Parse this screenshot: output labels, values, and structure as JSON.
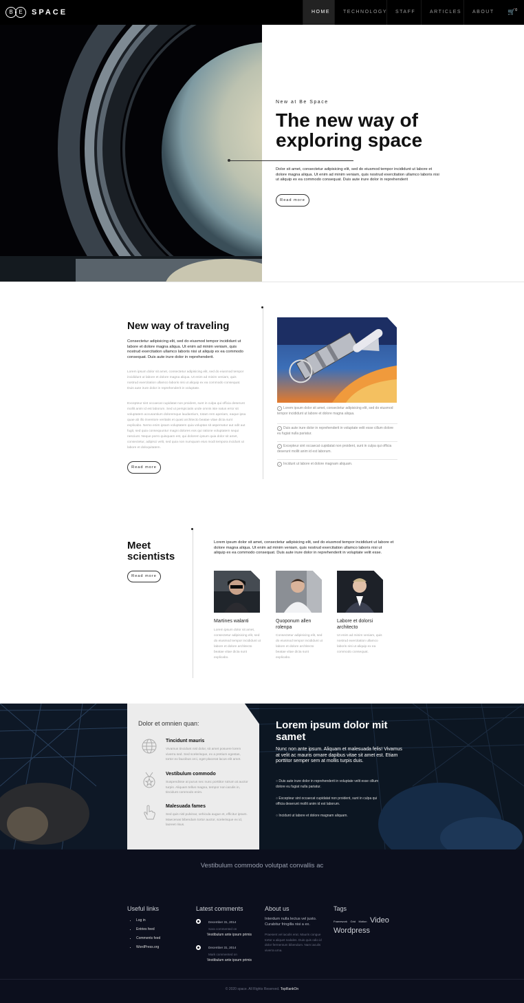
{
  "brand": {
    "logo_letters": "B E",
    "name": "SPACE"
  },
  "nav": {
    "items": [
      "HOME",
      "TECHNOLOGY",
      "STAFF",
      "ARTICLES",
      "ABOUT"
    ],
    "active": "HOME",
    "cart_count": "0"
  },
  "hero": {
    "kicker": "New at Be Space",
    "title": "The new way of exploring space",
    "text": "Dolor sit amet, consectetur adipisicing elit, sed do eiusmod tempor incididunt ut labore et dolore magna aliqua. Ut enim ad minim veniam, quis nostrud exercitation ullamco laboris nisi ut aliquip ex ea commodo consequat. Duis aute irure dolor in reprehenderit",
    "button": "Read more"
  },
  "traveling": {
    "title": "New way of traveling",
    "lead": "Consectetur adipisicing elit, sed do eiusmod tempor incididunt ut labore et dolore magna aliqua. Ut enim ad minim veniam, quis nostrud exercitation ullamco laboris nisi ut aliquip ex ea commodo consequat. Duis aute irure dolor in reprehenderit.",
    "para1": "Lorem ipsum dolor sit amet, consectetur adipisicing elit, sed do eiusmod tempor incididunt ut labore et dolore magna aliqua. Ut enim ad minim veniam, quis nostrud exercitation ullamco laboris nisi ut aliquip ex ea commodo consequat. Duis aute irure dolor in reprehenderit in voluptate.",
    "para2": "Excepteur sint occaecat cupidatat non proident, sunt in culpa qui officia deserunt mollit anim id est laborum. Sed ut perspiciatis unde omnis iste natus error sit voluptatem accusantium doloremque laudantium, totam rem aperiam, eaque ipsa quae ab illo inventore veritatis et quasi architecto beatae vitae dicta sunt explicabo. Nemo enim ipsam voluptatem quia voluptas sit aspernatur aut odit aut fugit, sed quia consequuntur magni dolores eos qui ratione voluptatem sequi nesciunt. Neque porro quisquam est, qui dolorem ipsum quia dolor sit amet, consectetur, adipisci velit, sed quia non numquam eius modi tempora incidunt ut labore et doloquitatem.",
    "button": "Read more",
    "checklist": [
      "Lorem ipsum dolor sit amet, consectetur adipisicing elit, sed do eiusmod tempor incididunt ut labore et dolore magna aliqua.",
      "Duis aute irure dolor in reprehenderit in voluptate velit esse cillum dolore eu fugiat nulla pariatur.",
      "Excepteur sint occaecat cupidatat non proident, sunt in culpa qui officia deserunt mollit anim id est laborum.",
      "Incidunt ut labore et dolore magnam aliquam."
    ]
  },
  "scientists": {
    "title": "Meet scientists",
    "intro": "Lorem ipsum dolor sit amet, consectetur adipisicing elit, sed do eiusmod tempor incididunt ut labore et dolore magna aliqua. Ut enim ad minim veniam, quis nostrud exercitation ullamco laboris nisi ut aliquip ex ea commodo consequat. Duis aute irure dolor in reprehenderit in voluptate velit esse.",
    "button": "Read more",
    "people": [
      {
        "name": "Martines walanti",
        "text": "Lorem ipsum dolor sit amet, consectetur adipisicing elit, sed do eiusmod tempor incididunt ut labore et dolore architecto beatae vitae dicta sunt explicabo."
      },
      {
        "name": "Quoponum allen rolenpa",
        "text": "Consectetur adipisicing elit, sed do eiusmod tempor incididunt ut labore et dolore architecto beatae vitae dicta sunt explicabo."
      },
      {
        "name": "Labore et dolorsi architecto",
        "text": "Ut enim ad minim veniam, quis nostrud exercitation ullamco laboris nisi ut aliquip ex ea commodo consequat."
      }
    ]
  },
  "features": {
    "panel_title": "Dolor et omnien quan:",
    "items": [
      {
        "icon": "globe-icon",
        "title": "Tincidunt mauris",
        "text": "Vivamus tincidunt nisl dolor, sit amet posuere lorem viverra sed. Sed scelerisque, ex a pretium egestas, tortor ex faucibus orci, eget placerat lacus elit amet."
      },
      {
        "icon": "medal-icon",
        "title": "Vestibulum commodo",
        "text": "Suspendisse at purus nec nunc porttitor rutrum at auctor turpis. Aliquam tellus magna, tempor non iaculis in, tincidunt commodo enim."
      },
      {
        "icon": "hand-icon",
        "title": "Malesuada fames",
        "text": "Sed quis nisl pulvinar, vehicula augue et, efficitur ipsum. Maecenas bibendum tortor auctor, scelerisque ex id, laoreet risus."
      }
    ],
    "title": "Lorem ipsum dolor mit samet",
    "sub": "Nunc non ante ipsum. Aliquam et malesuada felis! Vivamus at velit ac mauris ornare dapibus vitae sit amet est. Etiam porttitor semper sem at mollis turpis duis.",
    "list": [
      "Duis aute irure dolor in reprehenderit in voluptate velit esse cillum dolore eu fugiat nulla pariatur.",
      "Excepteur sint occaecat cupidatat non proident, sunt in culpa qui officia deserunt mollit anim id est laborum.",
      "Incidunt ut labore et dolore magnam aliquam."
    ]
  },
  "footer": {
    "quote": "Vestibulum commodo volutpat convallis ac",
    "useful": {
      "title": "Useful links",
      "links": [
        "Log in",
        "Entries feed",
        "Comments feed",
        "WordPress.org"
      ]
    },
    "comments": {
      "title": "Latest comments",
      "items": [
        {
          "date": "December 31, 2014",
          "meta": "Sara commented on",
          "post": "Vestibulum ante ipsum primis"
        },
        {
          "date": "December 31, 2014",
          "meta": "Mark commented on",
          "post": "Vestibulum ante ipsum primis"
        }
      ]
    },
    "about": {
      "title": "About us",
      "lead": "Interdum nulla lectus vel justo. Curabitur fringilla nisi a ex.",
      "text": "Praesent vel iaculis erat. Mauris congue tortor a aliquet sodales. Duis quis odio id dolor fermentum bibendum. Nam iaculis viverra urna."
    },
    "tags": {
      "title": "Tags",
      "items": [
        "Framework",
        "Grid",
        "Motion",
        "Video",
        "Wordpress"
      ]
    },
    "copyright": "© 2020 space. All Rights Reserved.",
    "credit": "TopRankOn"
  }
}
